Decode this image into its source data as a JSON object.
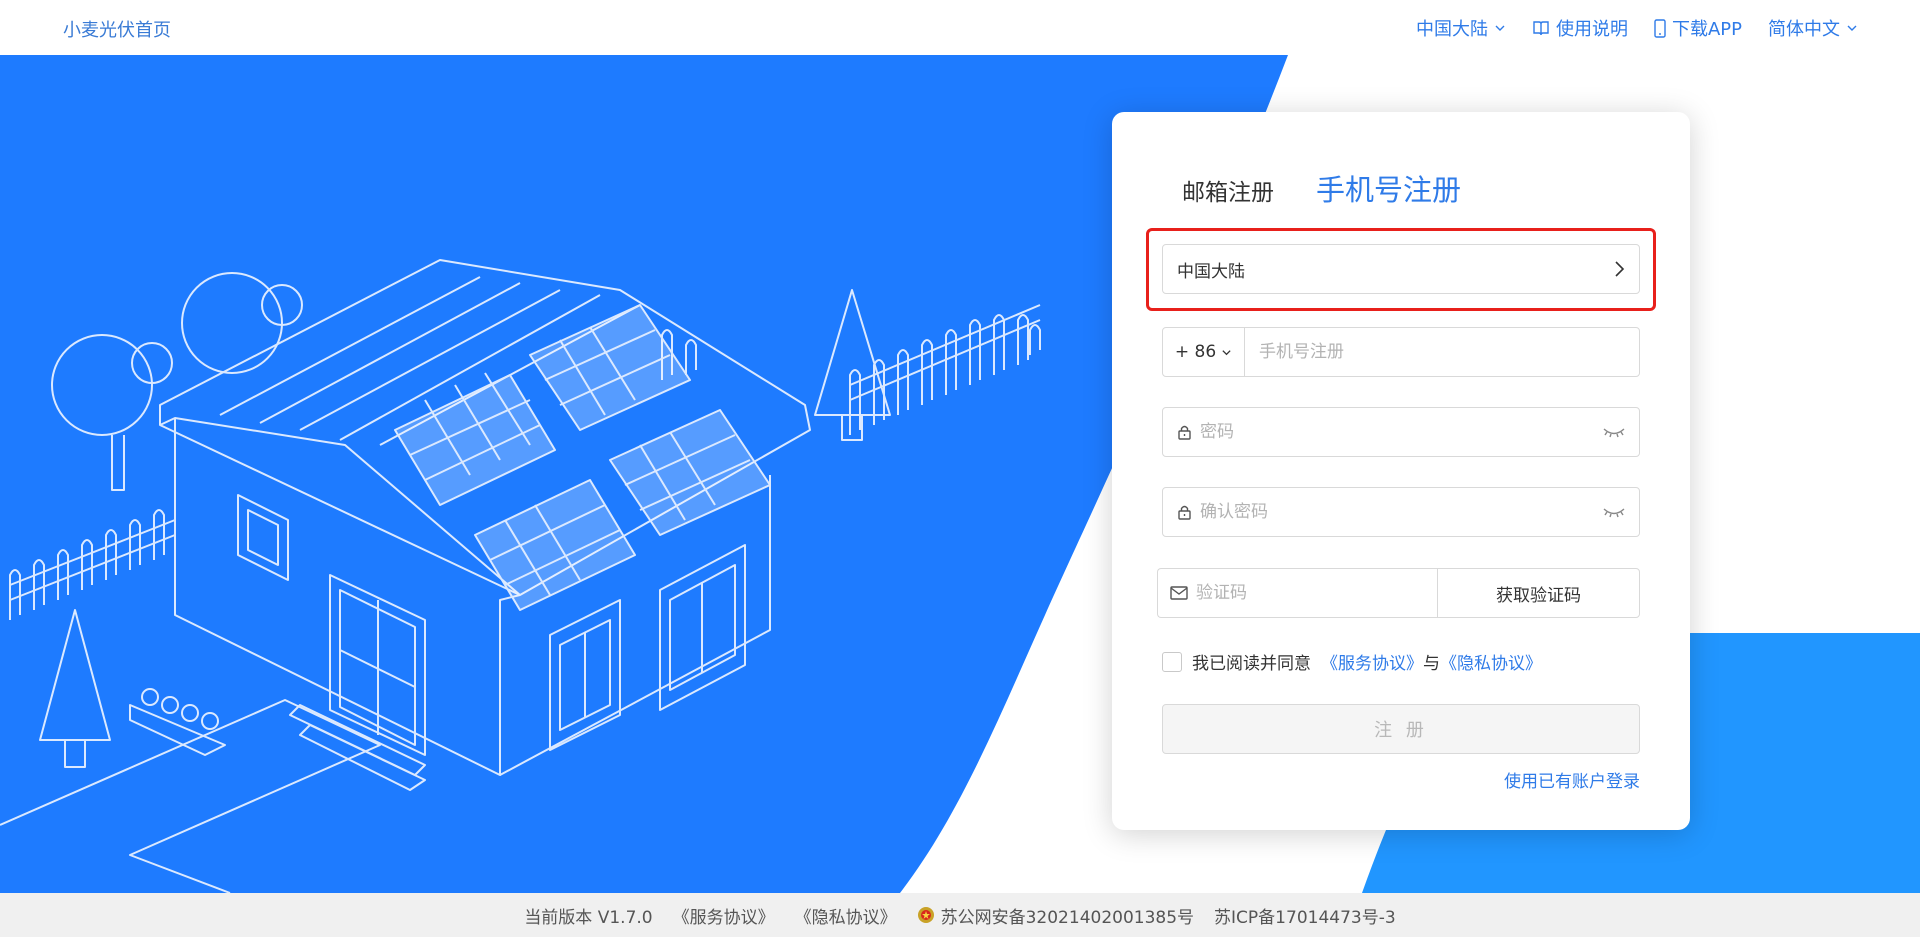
{
  "header": {
    "brand": "小麦光伏首页",
    "nav": {
      "region": "中国大陆",
      "manual": "使用说明",
      "download": "下载APP",
      "language": "简体中文"
    }
  },
  "form": {
    "tabs": {
      "email": "邮箱注册",
      "phone": "手机号注册"
    },
    "region_value": "中国大陆",
    "country_code": "+ 86",
    "phone_placeholder": "手机号注册",
    "password_placeholder": "密码",
    "confirm_placeholder": "确认密码",
    "code_placeholder": "验证码",
    "get_code": "获取验证码",
    "agree_text": "我已阅读并同意",
    "service_link": "《服务协议》",
    "and_text": "与",
    "privacy_link": "《隐私协议》",
    "submit": "注 册",
    "login_link": "使用已有账户登录"
  },
  "footer": {
    "version": "当前版本 V1.7.0",
    "service": "《服务协议》",
    "privacy": "《隐私协议》",
    "police": "苏公网安备32021402001385号",
    "icp": "苏ICP备17014473号-3"
  },
  "colors": {
    "primary_blue": "#1e7bff",
    "accent_blue": "#2f7be8",
    "highlight_red": "#e8201b"
  }
}
